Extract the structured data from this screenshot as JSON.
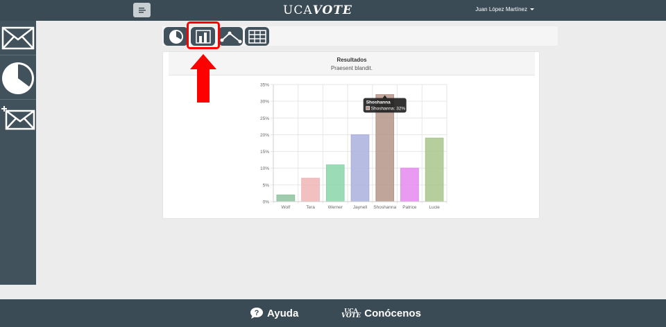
{
  "header": {
    "brand_part1": "UCA",
    "brand_part2": "VOTE",
    "user_name": "Juan López Martínez"
  },
  "sidebar": {
    "items": [
      {
        "icon": "envelope-icon"
      },
      {
        "icon": "pie-chart-icon"
      },
      {
        "icon": "new-envelope-icon"
      }
    ]
  },
  "toolbar": {
    "buttons": [
      {
        "icon": "pie-chart-icon"
      },
      {
        "icon": "bar-chart-icon",
        "selected": true
      },
      {
        "icon": "line-chart-icon"
      },
      {
        "icon": "table-icon"
      }
    ]
  },
  "card": {
    "title": "Resultados",
    "subtitle": "Praesent blandit."
  },
  "chart_data": {
    "type": "bar",
    "categories": [
      "Wolf",
      "Tera",
      "Werner",
      "Jaynell",
      "Shoshanna",
      "Patrice",
      "Lucie"
    ],
    "values": [
      2,
      7,
      11,
      20,
      32,
      10,
      19
    ],
    "colors": [
      "#8fc3a0",
      "#f0b5b5",
      "#8ad5a8",
      "#aab0dd",
      "#b5958a",
      "#e58af0",
      "#a9c58b"
    ],
    "ylim": [
      0,
      35
    ],
    "yticks": [
      "0%",
      "5%",
      "10%",
      "15%",
      "20%",
      "25%",
      "30%",
      "35%"
    ],
    "tooltip": {
      "title": "Shoshanna",
      "label": "Shoshanna: 32%"
    }
  },
  "footer": {
    "help_label": "Ayuda",
    "about_label": "Conócenos",
    "mini_logo_top": "UCA",
    "mini_logo_bottom": "VOTE"
  },
  "colors": {
    "navbar": "#3b4b55",
    "sidebar": "#41525c",
    "highlight": "#ff0000"
  }
}
